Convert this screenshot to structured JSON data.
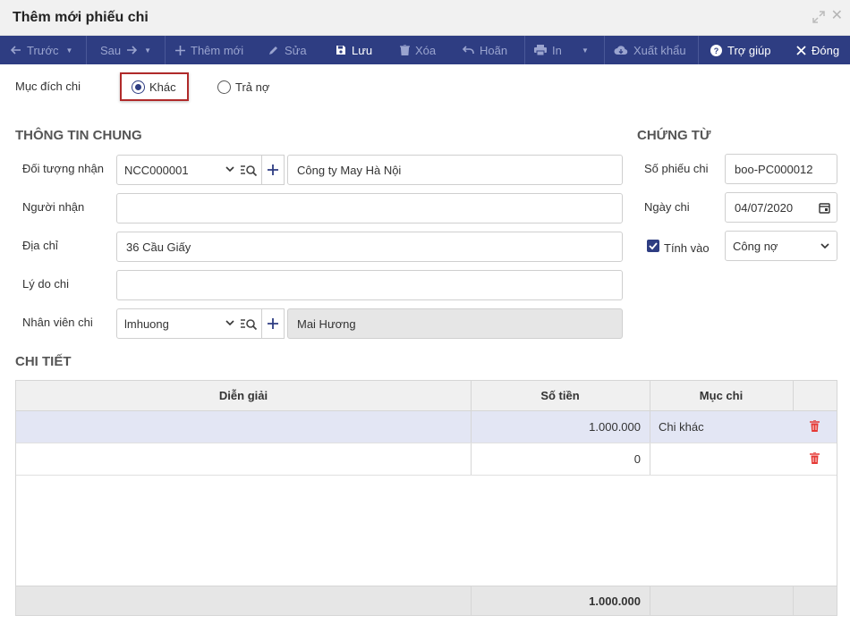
{
  "window": {
    "title": "Thêm mới phiếu chi"
  },
  "toolbar": {
    "prev": "Trước",
    "next": "Sau",
    "add": "Thêm mới",
    "edit": "Sửa",
    "save": "Lưu",
    "delete": "Xóa",
    "undo": "Hoãn",
    "print": "In",
    "export": "Xuất khẩu",
    "help": "Trợ giúp",
    "close": "Đóng"
  },
  "purpose": {
    "label": "Mục đích chi",
    "options": [
      "Khác",
      "Trả nợ"
    ],
    "selected": "Khác"
  },
  "general": {
    "title": "THÔNG TIN CHUNG",
    "recipient_object_label": "Đối tượng nhận",
    "recipient_object_code": "NCC000001",
    "recipient_object_name": "Công ty May Hà Nội",
    "receiver_label": "Người nhận",
    "receiver_value": "",
    "address_label": "Địa chỉ",
    "address_value": "36 Cầu Giấy",
    "reason_label": "Lý do chi",
    "reason_value": "",
    "employee_label": "Nhân viên chi",
    "employee_code": "lmhuong",
    "employee_name": "Mai Hương"
  },
  "voucher": {
    "title": "CHỨNG TỪ",
    "number_label": "Số phiếu chi",
    "number_value": "boo-PC000012",
    "date_label": "Ngày chi",
    "date_value": "04/07/2020",
    "include_label": "Tính vào",
    "include_checked": true,
    "include_value": "Công nợ"
  },
  "detail": {
    "title": "CHI TIẾT",
    "columns": [
      "Diễn giải",
      "Số tiền",
      "Mục chi"
    ],
    "rows": [
      {
        "description": "",
        "amount": "1.000.000",
        "category": "Chi khác"
      },
      {
        "description": "",
        "amount": "0",
        "category": ""
      }
    ],
    "total": "1.000.000"
  },
  "colors": {
    "toolbar": "#2e3d82",
    "highlight": "#b02a2a",
    "trash": "#e53935",
    "selected_row": "#e3e6f4"
  }
}
